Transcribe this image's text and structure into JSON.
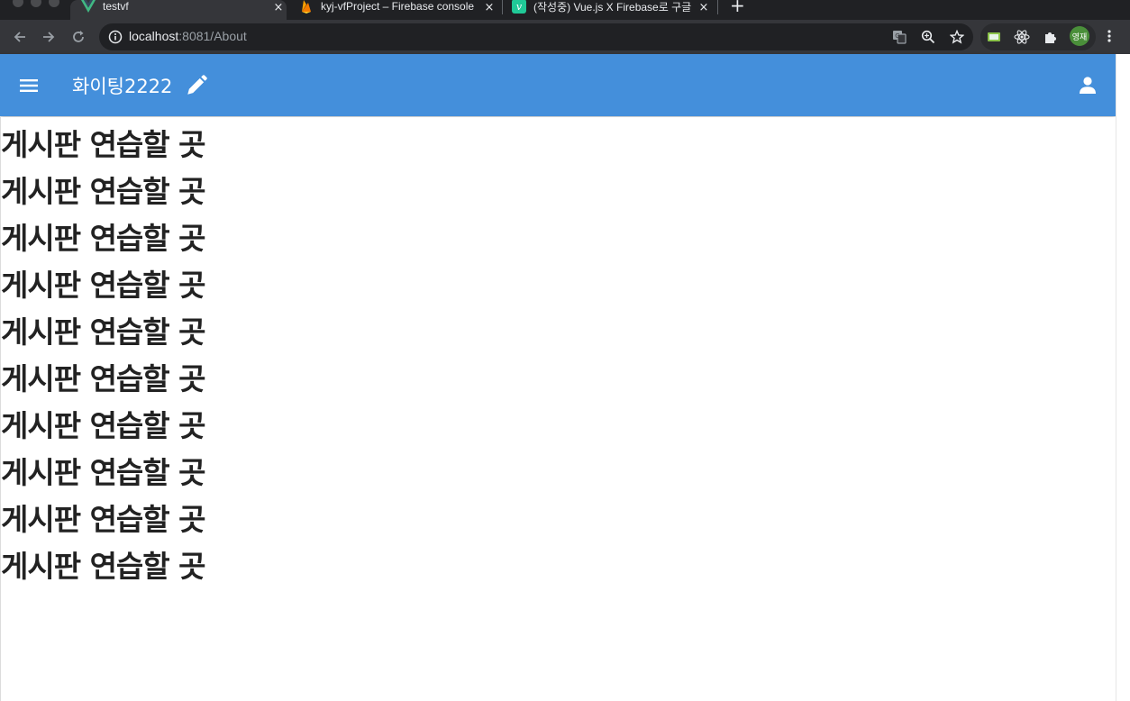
{
  "browser": {
    "tabs": [
      {
        "title": "testvf",
        "close": "×",
        "favicon": "vue-icon"
      },
      {
        "title": "kyj-vfProject – Firebase console",
        "close": "×",
        "favicon": "firebase-icon"
      },
      {
        "title": "(작성중) Vue.js X Firebase로 구글",
        "close": "×",
        "favicon": "velog-icon"
      }
    ],
    "new_tab": "+",
    "url_host": "localhost",
    "url_rest": ":8081/About",
    "profile_initials": "영재"
  },
  "app": {
    "title": "화이팅2222",
    "bar_color": "#448fdb"
  },
  "posts": [
    "게시판 연습할 곳",
    "게시판 연습할 곳",
    "게시판 연습할 곳",
    "게시판 연습할 곳",
    "게시판 연습할 곳",
    "게시판 연습할 곳",
    "게시판 연습할 곳",
    "게시판 연습할 곳",
    "게시판 연습할 곳",
    "게시판 연습할 곳"
  ]
}
